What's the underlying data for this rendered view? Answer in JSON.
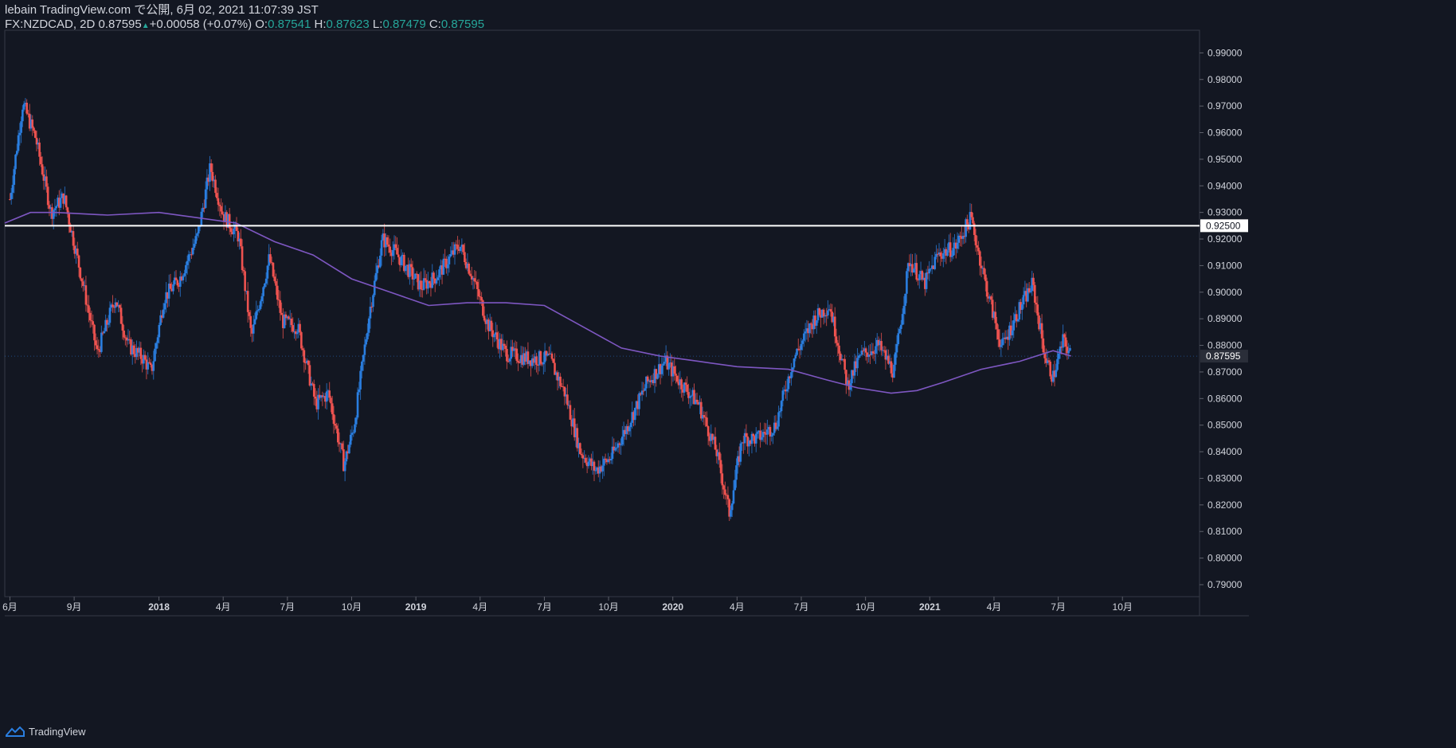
{
  "header": {
    "line1": "lebain TradingView.com で公開, 6月 02, 2021 11:07:39 JST",
    "symbol": "FX:NZDCAD, 2D",
    "last": "0.87595",
    "change": "+0.00058 (+0.07%)",
    "o_label": "O:",
    "o": "0.87541",
    "h_label": "H:",
    "h": "0.87623",
    "l_label": "L:",
    "l": "0.87479",
    "c_label": "C:",
    "c": "0.87595"
  },
  "footer": {
    "brand": "TradingView"
  },
  "colors": {
    "background": "#131722",
    "up": "#2a7ee0",
    "down": "#ef5350",
    "ma": "#7e57c2",
    "hline": "#ffffff",
    "grid": "#2a2e39",
    "text": "#d1d4dc"
  },
  "chart_data": {
    "type": "candlestick",
    "y_ticks": [
      "0.99000",
      "0.98000",
      "0.97000",
      "0.96000",
      "0.95000",
      "0.94000",
      "0.93000",
      "0.92000",
      "0.91000",
      "0.90000",
      "0.89000",
      "0.88000",
      "0.87000",
      "0.86000",
      "0.85000",
      "0.84000",
      "0.83000",
      "0.82000",
      "0.81000",
      "0.80000",
      "0.79000"
    ],
    "ylim": [
      0.7855,
      0.9985
    ],
    "x_ticks": [
      "6月",
      "9月",
      "2018",
      "4月",
      "7月",
      "10月",
      "2019",
      "4月",
      "7月",
      "10月",
      "2020",
      "4月",
      "7月",
      "10月",
      "2021",
      "4月",
      "7月",
      "10月"
    ],
    "horizontal_line": {
      "value": 0.925,
      "label": "0.92500"
    },
    "last_price_label": "0.87595",
    "last_price": 0.87595,
    "close_path": [
      [
        2017.42,
        0.935
      ],
      [
        2017.47,
        0.971
      ],
      [
        2017.52,
        0.958
      ],
      [
        2017.58,
        0.93
      ],
      [
        2017.63,
        0.936
      ],
      [
        2017.7,
        0.905
      ],
      [
        2017.76,
        0.877
      ],
      [
        2017.83,
        0.898
      ],
      [
        2017.88,
        0.88
      ],
      [
        2017.94,
        0.875
      ],
      [
        2017.97,
        0.87
      ],
      [
        2018.02,
        0.898
      ],
      [
        2018.08,
        0.905
      ],
      [
        2018.15,
        0.921
      ],
      [
        2018.2,
        0.947
      ],
      [
        2018.25,
        0.929
      ],
      [
        2018.31,
        0.921
      ],
      [
        2018.36,
        0.883
      ],
      [
        2018.43,
        0.913
      ],
      [
        2018.48,
        0.889
      ],
      [
        2018.54,
        0.887
      ],
      [
        2018.61,
        0.858
      ],
      [
        2018.66,
        0.862
      ],
      [
        2018.72,
        0.835
      ],
      [
        2018.76,
        0.85
      ],
      [
        2018.82,
        0.893
      ],
      [
        2018.87,
        0.92
      ],
      [
        2018.92,
        0.915
      ],
      [
        2019.02,
        0.902
      ],
      [
        2019.08,
        0.906
      ],
      [
        2019.17,
        0.918
      ],
      [
        2019.22,
        0.906
      ],
      [
        2019.28,
        0.888
      ],
      [
        2019.35,
        0.877
      ],
      [
        2019.44,
        0.875
      ],
      [
        2019.52,
        0.875
      ],
      [
        2019.58,
        0.862
      ],
      [
        2019.64,
        0.84
      ],
      [
        2019.7,
        0.833
      ],
      [
        2019.76,
        0.838
      ],
      [
        2019.82,
        0.849
      ],
      [
        2019.9,
        0.866
      ],
      [
        2019.97,
        0.874
      ],
      [
        2020.03,
        0.866
      ],
      [
        2020.1,
        0.858
      ],
      [
        2020.17,
        0.84
      ],
      [
        2020.22,
        0.817
      ],
      [
        2020.27,
        0.845
      ],
      [
        2020.33,
        0.845
      ],
      [
        2020.4,
        0.85
      ],
      [
        2020.47,
        0.875
      ],
      [
        2020.55,
        0.89
      ],
      [
        2020.61,
        0.895
      ],
      [
        2020.68,
        0.865
      ],
      [
        2020.73,
        0.876
      ],
      [
        2020.8,
        0.88
      ],
      [
        2020.86,
        0.87
      ],
      [
        2020.92,
        0.912
      ],
      [
        2020.98,
        0.903
      ],
      [
        2021.03,
        0.914
      ],
      [
        2021.1,
        0.917
      ],
      [
        2021.16,
        0.928
      ],
      [
        2021.22,
        0.902
      ],
      [
        2021.28,
        0.879
      ],
      [
        2021.34,
        0.892
      ],
      [
        2021.4,
        0.903
      ],
      [
        2021.45,
        0.875
      ],
      [
        2021.48,
        0.868
      ],
      [
        2021.52,
        0.882
      ],
      [
        2021.55,
        0.876
      ]
    ],
    "moving_average": [
      [
        2017.4,
        0.926
      ],
      [
        2017.5,
        0.93
      ],
      [
        2017.6,
        0.93
      ],
      [
        2017.8,
        0.929
      ],
      [
        2018.0,
        0.93
      ],
      [
        2018.15,
        0.928
      ],
      [
        2018.3,
        0.926
      ],
      [
        2018.45,
        0.919
      ],
      [
        2018.6,
        0.914
      ],
      [
        2018.75,
        0.905
      ],
      [
        2018.9,
        0.9
      ],
      [
        2019.05,
        0.895
      ],
      [
        2019.2,
        0.896
      ],
      [
        2019.35,
        0.896
      ],
      [
        2019.5,
        0.895
      ],
      [
        2019.65,
        0.887
      ],
      [
        2019.8,
        0.879
      ],
      [
        2019.95,
        0.876
      ],
      [
        2020.1,
        0.874
      ],
      [
        2020.25,
        0.872
      ],
      [
        2020.45,
        0.871
      ],
      [
        2020.6,
        0.867
      ],
      [
        2020.72,
        0.864
      ],
      [
        2020.85,
        0.862
      ],
      [
        2020.95,
        0.863
      ],
      [
        2021.05,
        0.866
      ],
      [
        2021.2,
        0.871
      ],
      [
        2021.35,
        0.874
      ],
      [
        2021.48,
        0.878
      ],
      [
        2021.55,
        0.876
      ]
    ]
  }
}
